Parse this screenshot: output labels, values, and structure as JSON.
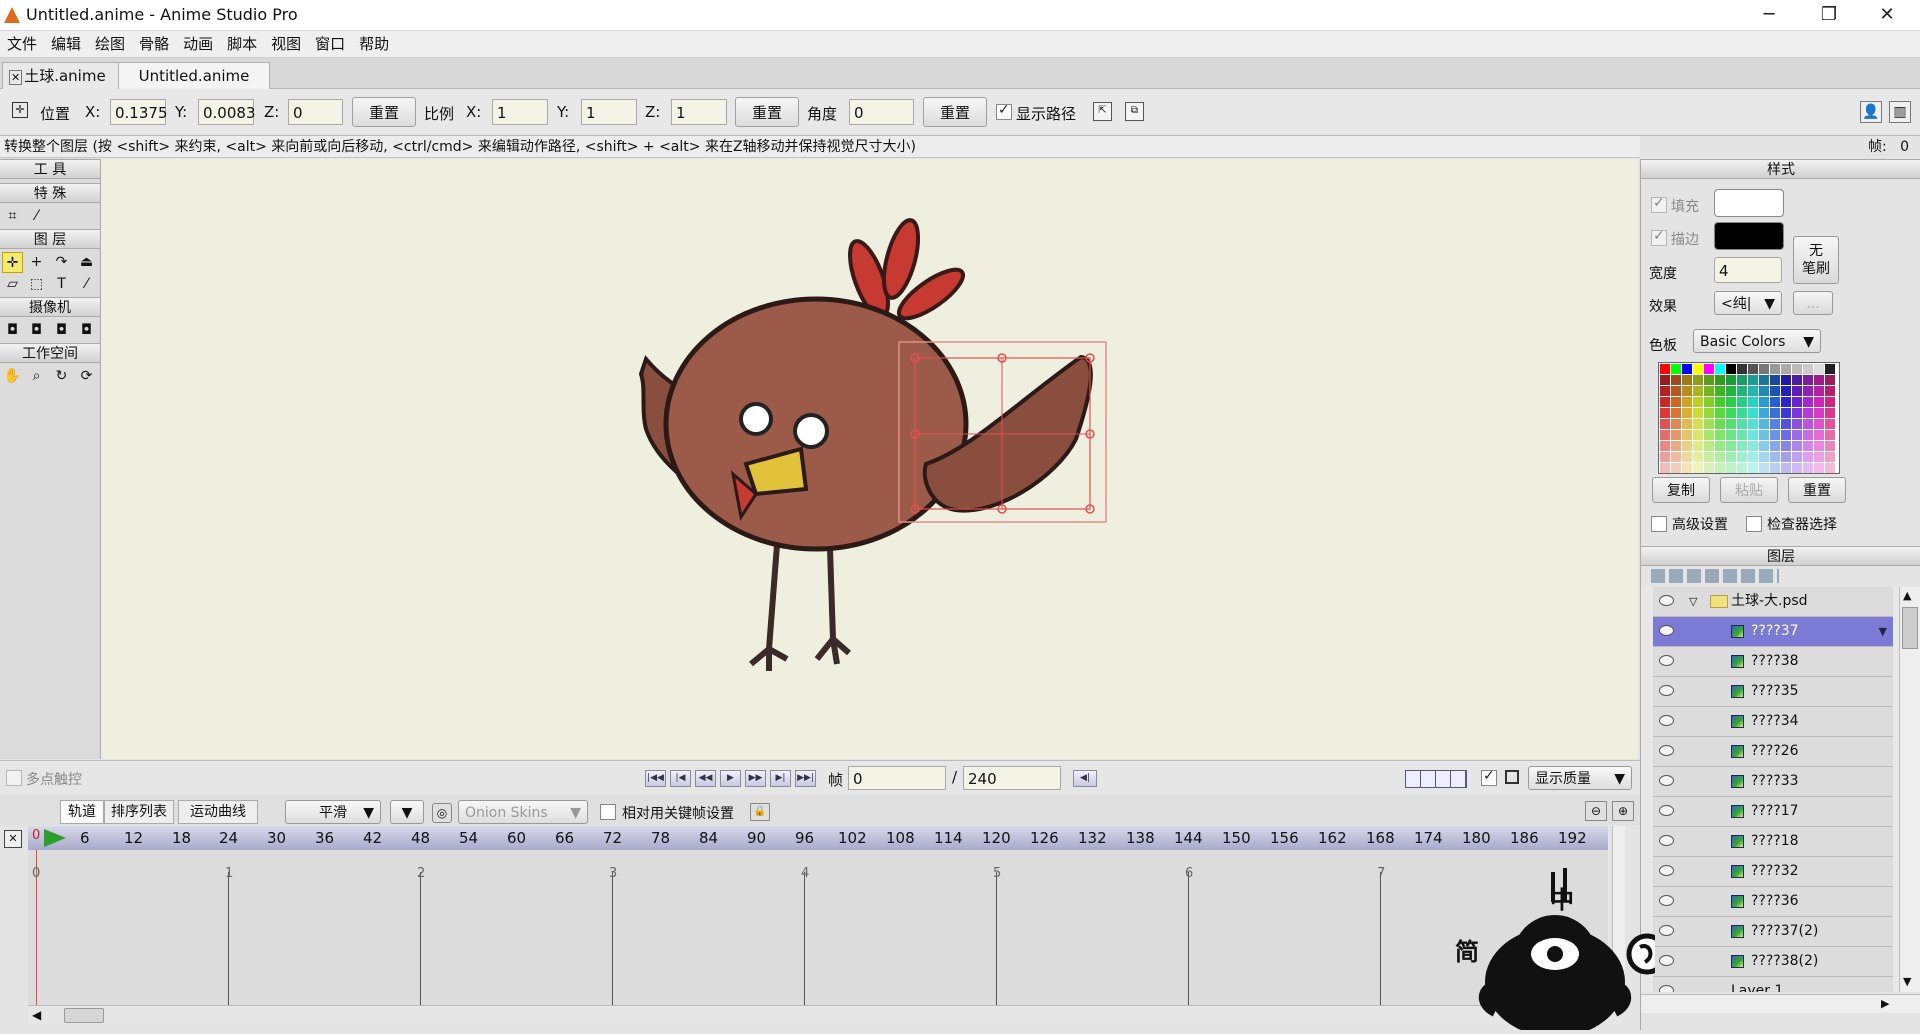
{
  "app": {
    "window_title": "Untitled.anime - Anime Studio Pro"
  },
  "window_controls": {
    "minimize": "─",
    "maximize": "❐",
    "close": "✕"
  },
  "menu": [
    "文件",
    "编辑",
    "绘图",
    "骨骼",
    "动画",
    "脚本",
    "视图",
    "窗口",
    "帮助"
  ],
  "doc_tabs": [
    {
      "label": "土球.anime",
      "active": false
    },
    {
      "label": "Untitled.anime",
      "active": true
    }
  ],
  "toolbar": {
    "position_label": "位置",
    "pos_x_label": "X:",
    "pos_x": "0.1375",
    "pos_y_label": "Y:",
    "pos_y": "0.0083",
    "pos_z_label": "Z:",
    "pos_z": "0",
    "reset1": "重置",
    "scale_label": "比例",
    "scale_x_label": "X:",
    "scale_x": "1",
    "scale_y_label": "Y:",
    "scale_y": "1",
    "scale_z_label": "Z:",
    "scale_z": "1",
    "reset2": "重置",
    "angle_label": "角度",
    "angle": "0",
    "reset3": "重置",
    "show_path_label": "显示路径"
  },
  "tip": {
    "text": "转换整个图层 (按 <shift> 来约束, <alt> 来向前或向后移动, <ctrl/cmd> 来编辑动作路径, <shift> + <alt> 来在Z轴移动并保持视觉尺寸大小)",
    "frame_label": "帧:",
    "frame_value": "0"
  },
  "tools": {
    "header": "工 具",
    "special": "特 殊",
    "layer": "图 层",
    "camera": "摄像机",
    "workspace": "工作空间",
    "text_tool": "T"
  },
  "transport": {
    "multi_touch": "多点触控",
    "frame_label": "帧",
    "frame_value": "0",
    "slash": "/",
    "total_frames": "240",
    "display_quality": "显示质量"
  },
  "timeline": {
    "tabs": [
      {
        "label": "轨道",
        "active": true
      },
      {
        "label": "排序列表",
        "active": false
      },
      {
        "label": "运动曲线",
        "active": false
      }
    ],
    "interp": "平滑",
    "onion": "Onion Skins",
    "relative_keys": "相对用关键帧设置",
    "ruler_start": "0",
    "ruler": [
      "6",
      "12",
      "18",
      "24",
      "30",
      "36",
      "42",
      "48",
      "54",
      "60",
      "66",
      "72",
      "78",
      "84",
      "90",
      "96",
      "102",
      "108",
      "114",
      "120",
      "126",
      "132",
      "138",
      "144",
      "150",
      "156",
      "162",
      "168",
      "174",
      "180",
      "186",
      "192"
    ],
    "seconds": [
      "0",
      "1",
      "2",
      "3",
      "4",
      "5",
      "6",
      "7"
    ]
  },
  "style_panel": {
    "header": "样式",
    "fill_label": "填充",
    "stroke_label": "描边",
    "fill_color": "#ffffff",
    "stroke_color": "#000000",
    "width_label": "宽度",
    "width_value": "4",
    "no_brush_line1": "无",
    "no_brush_line2": "笔刷",
    "effect_label": "效果",
    "effect_value": "<纯|",
    "more": "...",
    "palette_label": "色板",
    "palette_value": "Basic Colors",
    "copy": "复制",
    "paste": "粘贴",
    "reset": "重置",
    "advanced": "高级设置",
    "inspector": "检查器选择"
  },
  "layers_panel": {
    "header": "图层",
    "group": "土球-大.psd",
    "items": [
      {
        "name": "????37",
        "selected": true
      },
      {
        "name": "????38",
        "selected": false
      },
      {
        "name": "????35",
        "selected": false
      },
      {
        "name": "????34",
        "selected": false
      },
      {
        "name": "????26",
        "selected": false
      },
      {
        "name": "????33",
        "selected": false
      },
      {
        "name": "????17",
        "selected": false
      },
      {
        "name": "????18",
        "selected": false
      },
      {
        "name": "????32",
        "selected": false
      },
      {
        "name": "????36",
        "selected": false
      },
      {
        "name": "????37(2)",
        "selected": false
      },
      {
        "name": "????38(2)",
        "selected": false
      }
    ],
    "partial_layer": "Layer 1"
  },
  "overlay": {
    "ime_top": "中",
    "ime_left": "简"
  }
}
